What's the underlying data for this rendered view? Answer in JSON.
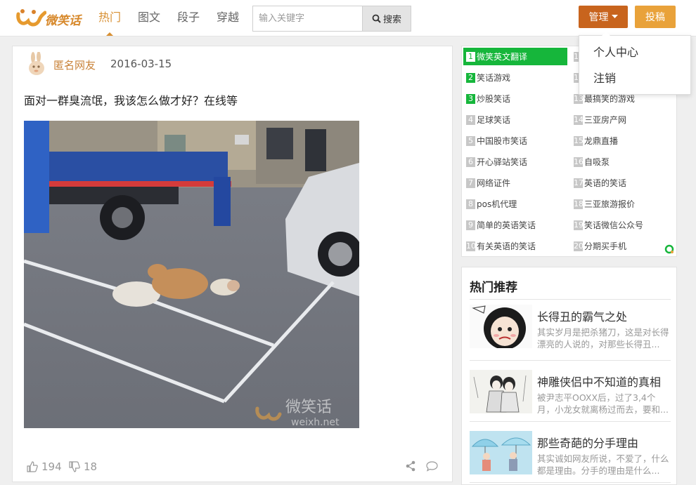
{
  "header": {
    "logo_text": "微笑话",
    "nav": [
      {
        "label": "热门",
        "active": true
      },
      {
        "label": "图文",
        "active": false
      },
      {
        "label": "段子",
        "active": false
      },
      {
        "label": "穿越",
        "active": false
      }
    ],
    "search_placeholder": "输入关键字",
    "search_button": "搜索",
    "manage_button": "管理",
    "post_button": "投稿",
    "dropdown": [
      "个人中心",
      "注销"
    ]
  },
  "post": {
    "author": "匿名网友",
    "date": "2016-03-15",
    "title": "面对一群臭流氓，我该怎么做才好？在线等",
    "watermark_cn": "微笑话",
    "watermark_url": "weixh.net",
    "likes": "194",
    "dislikes": "18"
  },
  "ranking": {
    "items": [
      {
        "num": "1",
        "label": "微笑英文翻译"
      },
      {
        "num": "2",
        "label": "笑话游戏"
      },
      {
        "num": "3",
        "label": "炒股笑话"
      },
      {
        "num": "4",
        "label": "足球笑话"
      },
      {
        "num": "5",
        "label": "中国股市笑话"
      },
      {
        "num": "6",
        "label": "开心驿站笑话"
      },
      {
        "num": "7",
        "label": "网络证件"
      },
      {
        "num": "8",
        "label": "pos机代理"
      },
      {
        "num": "9",
        "label": "简单的英语笑话"
      },
      {
        "num": "10",
        "label": "有关英语的笑话"
      },
      {
        "num": "11",
        "label": ""
      },
      {
        "num": "12",
        "label": ""
      },
      {
        "num": "13",
        "label": "最搞笑的游戏"
      },
      {
        "num": "14",
        "label": "三亚房产网"
      },
      {
        "num": "15",
        "label": "龙鼎直播"
      },
      {
        "num": "16",
        "label": "自吸泵"
      },
      {
        "num": "17",
        "label": "英语的笑话"
      },
      {
        "num": "18",
        "label": "三亚旅游报价"
      },
      {
        "num": "19",
        "label": "笑话微信公众号"
      },
      {
        "num": "20",
        "label": "分期买手机"
      }
    ]
  },
  "hot": {
    "title": "热门推荐",
    "items": [
      {
        "title": "长得丑的霸气之处",
        "desc": "其实岁月是把杀猪刀，这是对长得漂亮的人说的，对那些长得丑..."
      },
      {
        "title": "神雕侠侣中不知道的真相",
        "desc": "被尹志平OOXX后，过了3,4个月，小龙女就离杨过而去，要和..."
      },
      {
        "title": "那些奇葩的分手理由",
        "desc": "其实诚如网友所说，不爱了，什么都是理由。分手的理由是什么..."
      }
    ]
  },
  "colors": {
    "brand_orange": "#d89033",
    "manage_bg": "#c8641d",
    "post_bg": "#e9a23a",
    "rank_green": "#16b63b"
  }
}
